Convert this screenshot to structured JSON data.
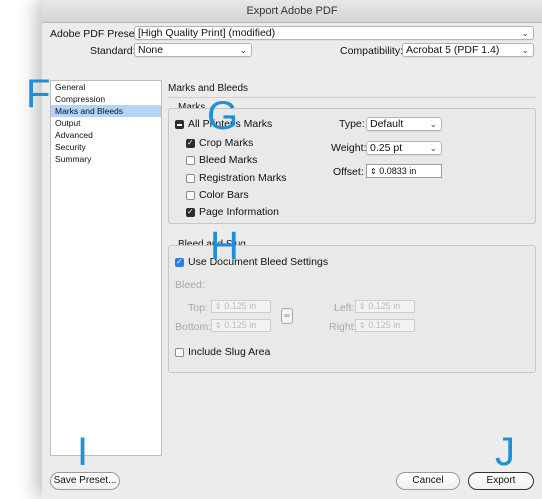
{
  "window": {
    "title": "Export Adobe PDF"
  },
  "preset": {
    "label": "Adobe PDF Preset:",
    "value": "[High Quality Print] (modified)"
  },
  "standard": {
    "label": "Standard:",
    "value": "None"
  },
  "compatibility": {
    "label": "Compatibility:",
    "value": "Acrobat 5 (PDF 1.4)"
  },
  "sidebar": {
    "items": [
      {
        "label": "General"
      },
      {
        "label": "Compression"
      },
      {
        "label": "Marks and Bleeds"
      },
      {
        "label": "Output"
      },
      {
        "label": "Advanced"
      },
      {
        "label": "Security"
      },
      {
        "label": "Summary"
      }
    ]
  },
  "content": {
    "title": "Marks and Bleeds"
  },
  "marks": {
    "group_label": "Marks",
    "all": {
      "label": "All Printer's Marks",
      "state": "mixed"
    },
    "items": [
      {
        "label": "Crop Marks",
        "checked": true
      },
      {
        "label": "Bleed Marks",
        "checked": false
      },
      {
        "label": "Registration Marks",
        "checked": false
      },
      {
        "label": "Color Bars",
        "checked": false
      },
      {
        "label": "Page Information",
        "checked": true
      }
    ],
    "type": {
      "label": "Type:",
      "value": "Default"
    },
    "weight": {
      "label": "Weight:",
      "value": "0.25 pt"
    },
    "offset": {
      "label": "Offset:",
      "value": "0.0833 in"
    }
  },
  "bleed": {
    "group_label": "Bleed and Slug",
    "use_doc": {
      "label": "Use Document Bleed Settings",
      "checked": true
    },
    "bleed_label": "Bleed:",
    "top": {
      "label": "Top:",
      "value": "0.125 in"
    },
    "bottom": {
      "label": "Bottom:",
      "value": "0.125 in"
    },
    "left": {
      "label": "Left:",
      "value": "0.125 in"
    },
    "right": {
      "label": "Right:",
      "value": "0.125 in"
    },
    "include_slug": {
      "label": "Include Slug Area",
      "checked": false
    }
  },
  "buttons": {
    "save_preset": "Save Preset...",
    "cancel": "Cancel",
    "export": "Export"
  },
  "markers": {
    "f": "F",
    "g": "G",
    "h": "H",
    "i": "I",
    "j": "J"
  },
  "colors": {
    "marker": "#1e8fd8",
    "selection": "#b4d3f5",
    "checkbox_blue": "#2f7ce8"
  }
}
